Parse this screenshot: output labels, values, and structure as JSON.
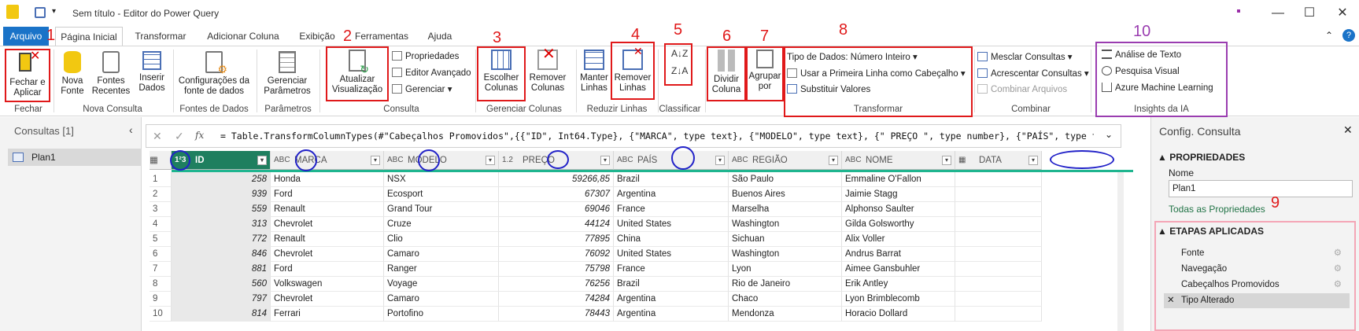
{
  "window": {
    "title": "Sem título - Editor do Power Query"
  },
  "tabs": [
    "Arquivo",
    "Página Inicial",
    "Transformar",
    "Adicionar Coluna",
    "Exibição",
    "Ferramentas",
    "Ajuda"
  ],
  "ribbon": {
    "close_apply": "Fechar e Aplicar",
    "new_source": "Nova Fonte",
    "recent_sources": "Fontes Recentes",
    "enter_data": "Inserir Dados",
    "ds_settings": "Configurações da fonte de dados",
    "manage_params": "Gerenciar Parâmetros",
    "refresh_preview": "Atualizar Visualização",
    "properties": "Propriedades",
    "adv_editor": "Editor Avançado",
    "manage": "Gerenciar",
    "choose_cols": "Escolher Colunas",
    "remove_cols": "Remover Colunas",
    "keep_rows": "Manter Linhas",
    "remove_rows": "Remover Linhas",
    "split_col": "Dividir Coluna",
    "group_by": "Agrupar por",
    "data_type": "Tipo de Dados: Número Inteiro",
    "first_row_header": "Usar a Primeira Linha como Cabeçalho",
    "replace_values": "Substituir Valores",
    "merge_queries": "Mesclar Consultas",
    "append_queries": "Acrescentar Consultas",
    "combine_files": "Combinar Arquivos",
    "text_analysis": "Análise de Texto",
    "vision": "Pesquisa Visual",
    "azure_ml": "Azure Machine Learning",
    "groups": {
      "close": "Fechar",
      "new_query": "Nova Consulta",
      "data_sources": "Fontes de Dados",
      "params": "Parâmetros",
      "query": "Consulta",
      "manage_cols": "Gerenciar Colunas",
      "reduce_rows": "Reduzir Linhas",
      "sort": "Classificar",
      "transform": "Transformar",
      "combine": "Combinar",
      "ai": "Insights da IA"
    },
    "annotations": [
      "1",
      "2",
      "3",
      "4",
      "5",
      "6",
      "7",
      "8",
      "9",
      "10"
    ]
  },
  "queries_pane": {
    "title": "Consultas [1]",
    "item": "Plan1"
  },
  "formula": "= Table.TransformColumnTypes(#\"Cabeçalhos Promovidos\",{{\"ID\", Int64.Type}, {\"MARCA\", type text}, {\"MODELO\", type text}, {\" PREÇO \", type number}, {\"PAÍS\", type text},",
  "columns": [
    {
      "type": "1²3",
      "name": "ID"
    },
    {
      "type": "ABC",
      "name": "MARCA"
    },
    {
      "type": "ABC",
      "name": "MODELO"
    },
    {
      "type": "1.2",
      "name": "PREÇO"
    },
    {
      "type": "ABC",
      "name": "PAÍS"
    },
    {
      "type": "ABC",
      "name": "REGIÃO"
    },
    {
      "type": "ABC",
      "name": "NOME"
    },
    {
      "type": "cal",
      "name": "DATA"
    }
  ],
  "rows": [
    [
      "1",
      "258",
      "Honda",
      "NSX",
      "59266,85",
      "Brazil",
      "São Paulo",
      "Emmaline O'Fallon"
    ],
    [
      "2",
      "939",
      "Ford",
      "Ecosport",
      "67307",
      "Argentina",
      "Buenos Aires",
      "Jaimie Stagg"
    ],
    [
      "3",
      "559",
      "Renault",
      "Grand Tour",
      "69046",
      "France",
      "Marselha",
      "Alphonso Saulter"
    ],
    [
      "4",
      "313",
      "Chevrolet",
      "Cruze",
      "44124",
      "United States",
      "Washington",
      "Gilda Golsworthy"
    ],
    [
      "5",
      "772",
      "Renault",
      "Clio",
      "77895",
      "China",
      "Sichuan",
      "Alix Voller"
    ],
    [
      "6",
      "846",
      "Chevrolet",
      "Camaro",
      "76092",
      "United States",
      "Washington",
      "Andrus Barrat"
    ],
    [
      "7",
      "881",
      "Ford",
      "Ranger",
      "75798",
      "France",
      "Lyon",
      "Aimee Gansbuhler"
    ],
    [
      "8",
      "560",
      "Volkswagen",
      "Voyage",
      "76256",
      "Brazil",
      "Rio de Janeiro",
      "Erik Antley"
    ],
    [
      "9",
      "797",
      "Chevrolet",
      "Camaro",
      "74284",
      "Argentina",
      "Chaco",
      "Lyon Brimblecomb"
    ],
    [
      "10",
      "814",
      "Ferrari",
      "Portofino",
      "78443",
      "Argentina",
      "Mendonza",
      "Horacio Dollard"
    ]
  ],
  "settings": {
    "title": "Config. Consulta",
    "props_header": "PROPRIEDADES",
    "name_label": "Nome",
    "name_value": "Plan1",
    "all_props": "Todas as Propriedades",
    "steps_header": "ETAPAS APLICADAS",
    "steps": [
      "Fonte",
      "Navegação",
      "Cabeçalhos Promovidos",
      "Tipo Alterado"
    ]
  }
}
